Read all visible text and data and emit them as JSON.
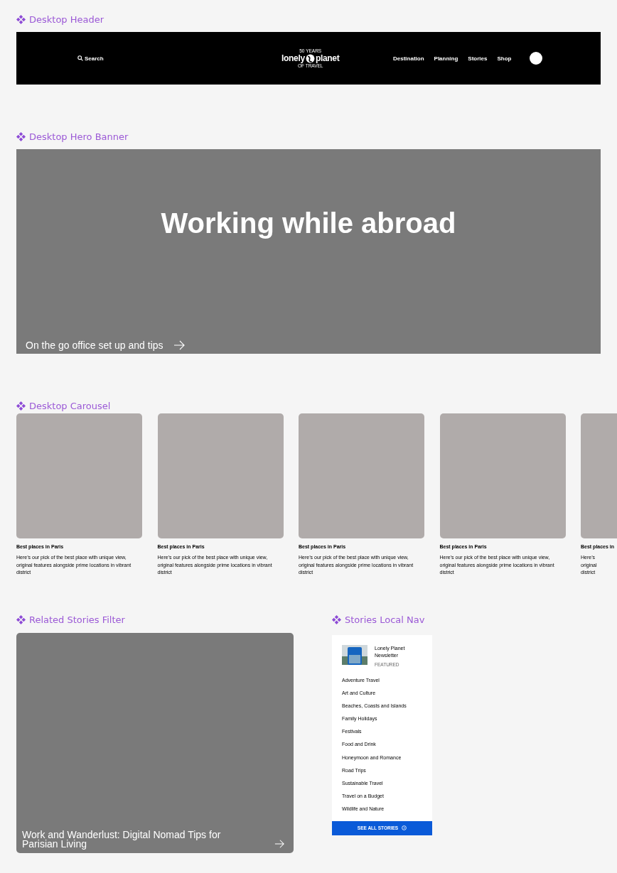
{
  "sections": {
    "header": "Desktop Header",
    "hero": "Desktop Hero Banner",
    "carousel": "Desktop Carousel",
    "related": "Related Stories Filter",
    "localnav": "Stories Local Nav"
  },
  "header": {
    "search": "Search",
    "logo": {
      "top": "50 YEARS",
      "name_left": "lonely",
      "name_right": "planet",
      "bottom": "OF TRAVEL"
    },
    "nav": [
      "Destination",
      "Planning",
      "Stories",
      "Shop"
    ]
  },
  "hero": {
    "title": "Working while abroad",
    "link": "On the go office set up and tips"
  },
  "carousel": [
    {
      "kind": "full",
      "title": "Best places in Paris",
      "description": "Here’s our pick of the best place with unique view, original features alongside prime locations in vibrant district"
    },
    {
      "kind": "full",
      "title": "Best places in Paris",
      "description": "Here’s our pick of the best place with unique view, original features alongside prime locations in vibrant district"
    },
    {
      "kind": "full",
      "title": "Best places in Paris",
      "description": "Here’s our pick of the best place with unique view, original features alongside prime locations in vibrant district"
    },
    {
      "kind": "full",
      "title": "Best places in Paris",
      "description": "Here’s our pick of the best place with unique view, original features alongside prime locations in vibrant district"
    },
    {
      "kind": "partial",
      "title": "Best places in",
      "lines": [
        "Here’s",
        "original",
        "district"
      ]
    }
  ],
  "related": {
    "title": "Work and Wanderlust: Digital Nomad Tips for Parisian Living"
  },
  "localnav": {
    "featured": {
      "title": "Lonely Planet Newsletter",
      "tag": "FEATURED"
    },
    "items": [
      "Adventure Travel",
      "Art and Culture",
      "Beaches, Coasts and Islands",
      "Family Holidays",
      "Festivals",
      "Food and Drink",
      "Honeymoon and Romance",
      "Road Trips",
      "Sustainable Travel",
      "Travel on a Budget",
      "Wildlife and Nature"
    ],
    "button": "SEE ALL STORIES"
  }
}
